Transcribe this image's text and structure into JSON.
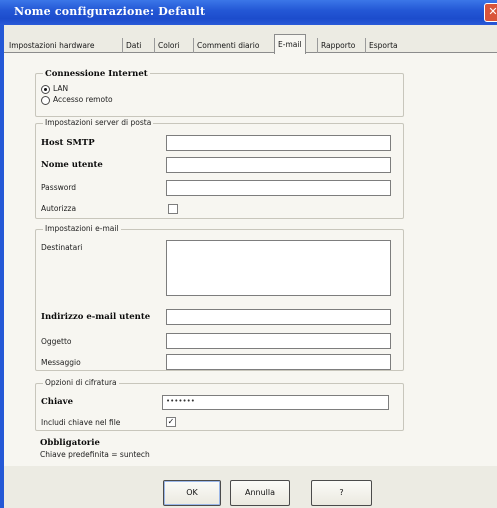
{
  "window": {
    "title": "Nome configurazione: Default",
    "close_glyph": "✕"
  },
  "tabs": [
    {
      "label": "Impostazioni hardware"
    },
    {
      "label": "Dati"
    },
    {
      "label": "Colori"
    },
    {
      "label": "Commenti diario"
    },
    {
      "label": "E-mail",
      "active": true
    },
    {
      "label": "Rapporto"
    },
    {
      "label": "Esporta"
    }
  ],
  "connection": {
    "heading": "Connessione Internet",
    "options": [
      {
        "label": "LAN",
        "selected": true
      },
      {
        "label": "Accesso remoto",
        "selected": false
      }
    ]
  },
  "server": {
    "legend": "Impostazioni server di posta",
    "host_label": "Host SMTP",
    "host_value": "",
    "user_label": "Nome utente",
    "user_value": "",
    "password_label": "Password",
    "password_value": "",
    "auth_label": "Autorizza",
    "auth_checked": false
  },
  "email": {
    "legend": "Impostazioni e-mail",
    "recipients_label": "Destinatari",
    "recipients_value": "",
    "user_address_label": "Indirizzo e-mail utente",
    "user_address_value": "",
    "subject_label": "Oggetto",
    "subject_value": "",
    "message_label": "Messaggio",
    "message_value": ""
  },
  "encryption": {
    "legend": "Opzioni di cifratura",
    "key_label": "Chiave",
    "key_value": "•••••••",
    "include_key_label": "Includi chiave nel file",
    "include_key_checked": true,
    "check_glyph": "✓"
  },
  "required": {
    "heading": "Obbligatorie",
    "note": "Chiave predefinita = suntech"
  },
  "buttons": {
    "ok": "OK",
    "cancel": "Annulla",
    "help": "?"
  }
}
